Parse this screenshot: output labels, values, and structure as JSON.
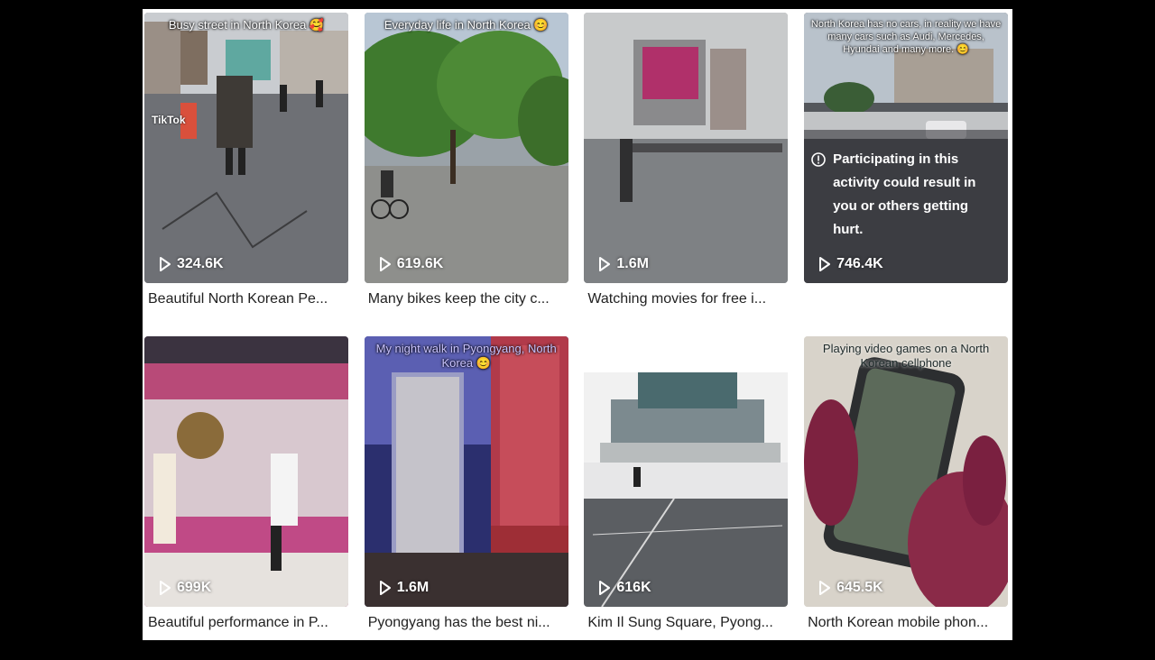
{
  "videos": [
    {
      "overlay": "Busy street in North Korea 🥰",
      "views": "324.6K",
      "caption": "Beautiful North Korean Pe...",
      "watermark": "TikTok",
      "scene": "street"
    },
    {
      "overlay": "Everyday life in North Korea 😊",
      "views": "619.6K",
      "caption": "Many bikes keep the city c...",
      "scene": "trees"
    },
    {
      "overlay": "",
      "views": "1.6M",
      "caption": "Watching movies for free i...",
      "scene": "screen"
    },
    {
      "overlay": "North Korea has no cars, in reality we have many cars such as Audi, Mercedes, Hyundai and many more. 😊",
      "views": "746.4K",
      "caption": "",
      "warning": "Participating in this activity could result in you or others getting hurt.",
      "scene": "cars"
    },
    {
      "overlay": "",
      "views": "699K",
      "caption": "Beautiful performance in P...",
      "scene": "stage"
    },
    {
      "overlay": "My night walk in Pyongyang, North Korea 😊",
      "views": "1.6M",
      "caption": "Pyongyang has the best ni...",
      "scene": "night"
    },
    {
      "overlay": "",
      "views": "616K",
      "caption": "Kim Il Sung Square, Pyong...",
      "scene": "square"
    },
    {
      "overlay": "Playing video games on a North Korean cellphone",
      "views": "645.5K",
      "caption": "North Korean mobile phon...",
      "scene": "phone"
    }
  ],
  "icons": {
    "play": "play-icon",
    "warning": "info-icon"
  },
  "colors": {
    "page_bg": "#000000",
    "panel_bg": "#ffffff",
    "caption_text": "#222222"
  }
}
